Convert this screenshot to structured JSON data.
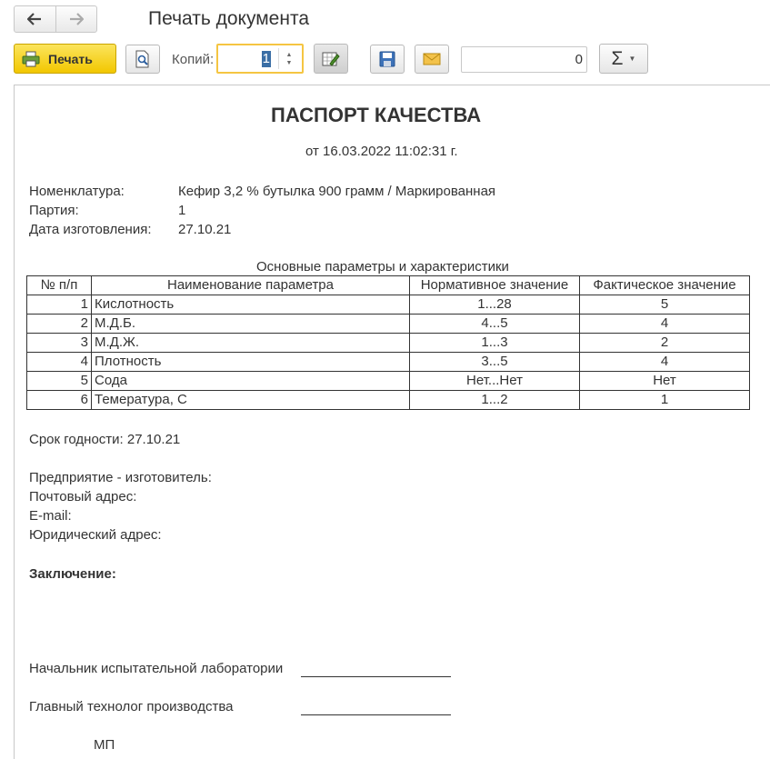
{
  "window": {
    "title": "Печать документа"
  },
  "toolbar": {
    "print_label": "Печать",
    "copies_label": "Копий:",
    "copies_value": "1",
    "sum_value": "0",
    "sum_symbol": "Σ"
  },
  "document": {
    "title": "ПАСПОРТ КАЧЕСТВА",
    "date_line": "от 16.03.2022 11:02:31 г.",
    "info": [
      {
        "label": "Номенклатура:",
        "value": "Кефир 3,2 % бутылка 900 грамм / Маркированная"
      },
      {
        "label": "Партия:",
        "value": "1"
      },
      {
        "label": "Дата изготовления:",
        "value": "27.10.21"
      }
    ],
    "table": {
      "caption": "Основные параметры и характеристики",
      "headers": [
        "№ п/п",
        "Наименование параметра",
        "Нормативное значение",
        "Фактическое значение"
      ],
      "rows": [
        [
          "1",
          "Кислотность",
          "1...28",
          "5"
        ],
        [
          "2",
          "М.Д.Б.",
          "4...5",
          "4"
        ],
        [
          "3",
          "М.Д.Ж.",
          "1...3",
          "2"
        ],
        [
          "4",
          "Плотность",
          "3...5",
          "4"
        ],
        [
          "5",
          "Сода",
          "Нет...Нет",
          "Нет"
        ],
        [
          "6",
          "Темература, С",
          "1...2",
          "1"
        ]
      ]
    },
    "shelf_life": "Срок годности:  27.10.21",
    "manufacturer": [
      "Предприятие - изготовитель:",
      "Почтовый адрес:",
      "E-mail:",
      "Юридический адрес:"
    ],
    "conclusion_label": "Заключение:",
    "signatures": [
      "Начальник испытательной лаборатории",
      "Главный технолог производства"
    ],
    "stamp": "МП"
  },
  "icons": [
    "arrow-left-icon",
    "arrow-right-icon",
    "printer-icon",
    "preview-icon",
    "edit-icon",
    "save-icon",
    "mail-icon"
  ]
}
